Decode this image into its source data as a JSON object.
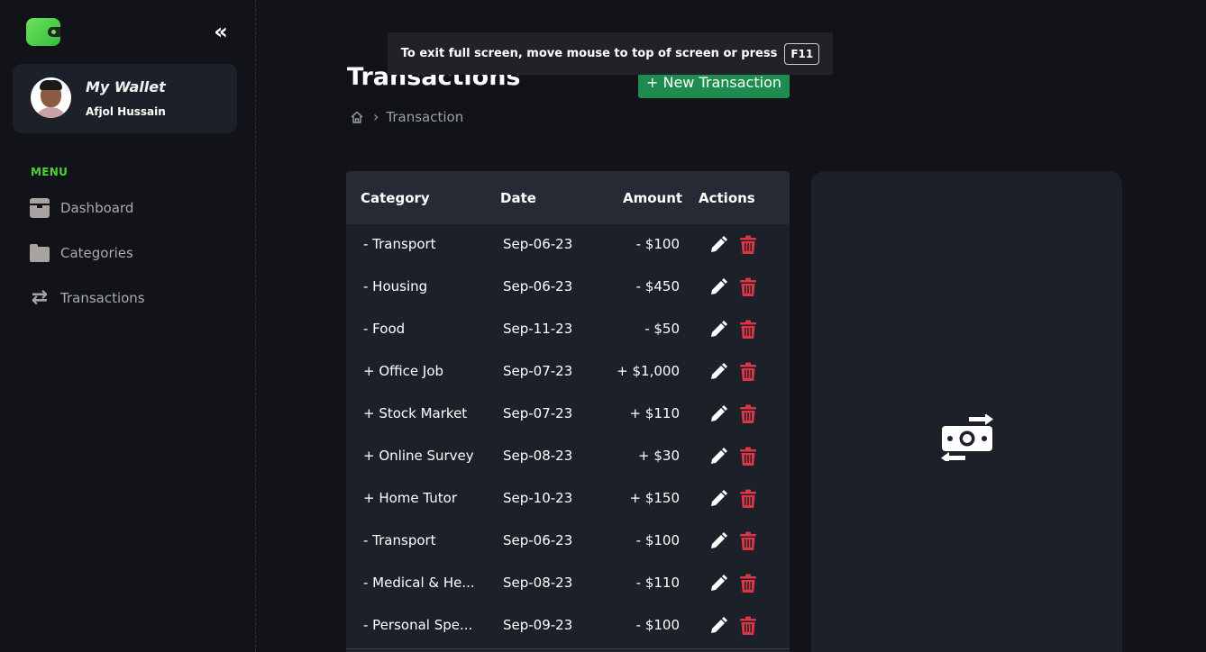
{
  "sidebar": {
    "wallet_title": "My Wallet",
    "user_name": "Afjol Hussain",
    "menu_heading": "MENU",
    "items": [
      {
        "label": "Dashboard",
        "icon": "box-icon"
      },
      {
        "label": "Categories",
        "icon": "folder-icon"
      },
      {
        "label": "Transactions",
        "icon": "swap-arrows-icon"
      }
    ]
  },
  "banner": {
    "text": "To exit full screen, move mouse to top of screen or press",
    "key": "F11"
  },
  "header": {
    "title": "Transactions",
    "new_button": "+ New Transaction",
    "breadcrumb_current": "Transaction"
  },
  "table": {
    "columns": [
      "Category",
      "Date",
      "Amount",
      "Actions"
    ],
    "rows": [
      {
        "category": "- Transport",
        "date": "Sep-06-23",
        "amount": "- $100"
      },
      {
        "category": "- Housing",
        "date": "Sep-06-23",
        "amount": "- $450"
      },
      {
        "category": "- Food",
        "date": "Sep-11-23",
        "amount": "- $50"
      },
      {
        "category": "+ Office Job",
        "date": "Sep-07-23",
        "amount": "+ $1,000"
      },
      {
        "category": "+ Stock Market",
        "date": "Sep-07-23",
        "amount": "+ $110"
      },
      {
        "category": "+ Online Survey",
        "date": "Sep-08-23",
        "amount": "+ $30"
      },
      {
        "category": "+ Home Tutor",
        "date": "Sep-10-23",
        "amount": "+ $150"
      },
      {
        "category": "- Transport",
        "date": "Sep-06-23",
        "amount": "- $100"
      },
      {
        "category": "- Medical & He...",
        "date": "Sep-08-23",
        "amount": "- $110"
      },
      {
        "category": "- Personal Spe...",
        "date": "Sep-09-23",
        "amount": "- $100"
      }
    ]
  },
  "colors": {
    "accent_green": "#4cd137",
    "button_green": "#1e8c4e",
    "delete_red": "#dc3545",
    "background": "#111319",
    "card": "#1c2028"
  }
}
